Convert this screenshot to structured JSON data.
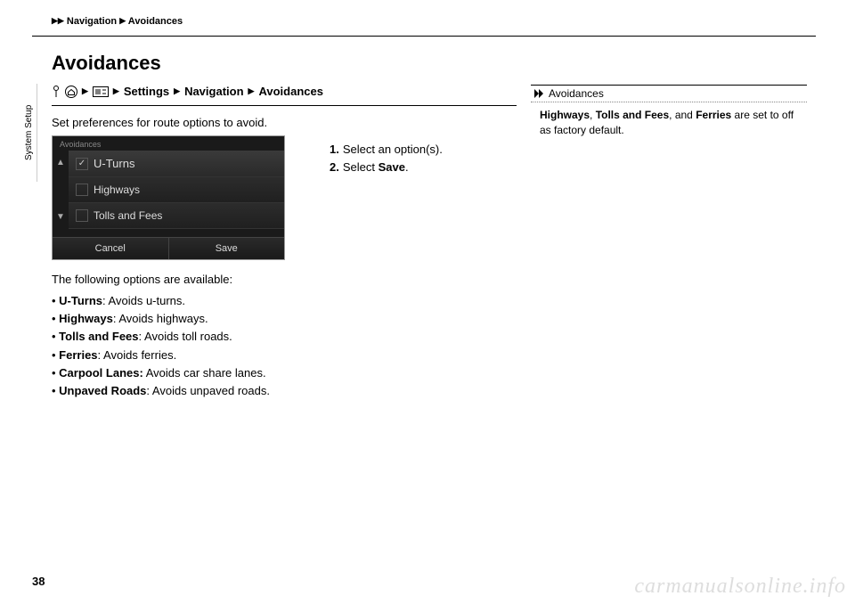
{
  "breadcrumb": {
    "part1": "Navigation",
    "part2": "Avoidances"
  },
  "sidebar": {
    "label": "System Setup"
  },
  "title": "Avoidances",
  "path": {
    "settings": "Settings",
    "navigation": "Navigation",
    "avoidances": "Avoidances"
  },
  "intro": "Set preferences for route options to avoid.",
  "screen": {
    "caption": "Avoidances",
    "items": [
      "U-Turns",
      "Highways",
      "Tolls and Fees"
    ],
    "cancel": "Cancel",
    "save": "Save"
  },
  "steps": {
    "s1num": "1.",
    "s1": "Select an option(s).",
    "s2num": "2.",
    "s2a": "Select ",
    "s2b": "Save",
    "s2c": "."
  },
  "optionsLead": "The following options are available:",
  "options": [
    {
      "name": "U-Turns",
      "desc": ": Avoids u-turns."
    },
    {
      "name": "Highways",
      "desc": ": Avoids highways."
    },
    {
      "name": "Tolls and Fees",
      "desc": ": Avoids toll roads."
    },
    {
      "name": "Ferries",
      "desc": ": Avoids ferries."
    },
    {
      "name": "Carpool Lanes:",
      "desc": " Avoids car share lanes."
    },
    {
      "name": "Unpaved Roads",
      "desc": ": Avoids unpaved roads."
    }
  ],
  "noteHeader": "Avoidances",
  "noteA": "Highways",
  "noteB": ", ",
  "noteC": "Tolls and Fees",
  "noteD": ", and ",
  "noteE": "Ferries",
  "noteF": " are set to off as factory default.",
  "pageNumber": "38",
  "watermark": "carmanualsonline.info"
}
